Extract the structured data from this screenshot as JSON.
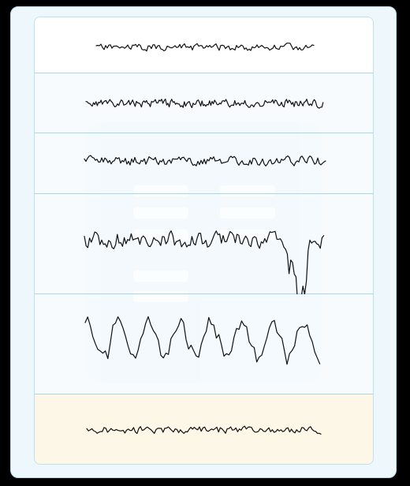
{
  "traces": [
    {
      "id": "trace-1",
      "amplitude": 0.12,
      "frequency": "high",
      "highlighted": false
    },
    {
      "id": "trace-2",
      "amplitude": 0.15,
      "frequency": "very-high",
      "highlighted": false
    },
    {
      "id": "trace-3",
      "amplitude": 0.18,
      "frequency": "high",
      "highlighted": false
    },
    {
      "id": "trace-4",
      "amplitude": 0.55,
      "frequency": "mixed",
      "highlighted": false
    },
    {
      "id": "trace-5",
      "amplitude": 0.85,
      "frequency": "low",
      "highlighted": false
    },
    {
      "id": "trace-6",
      "amplitude": 0.15,
      "frequency": "high",
      "highlighted": true
    }
  ],
  "colors": {
    "background": "#000000",
    "card": "#eef7fc",
    "card_border": "#b9dcee",
    "row_divider": "#a9d6e8",
    "highlight_row": "#fdf7e8",
    "trace": "#111111"
  },
  "icons": {
    "watermark": "document-icon"
  }
}
